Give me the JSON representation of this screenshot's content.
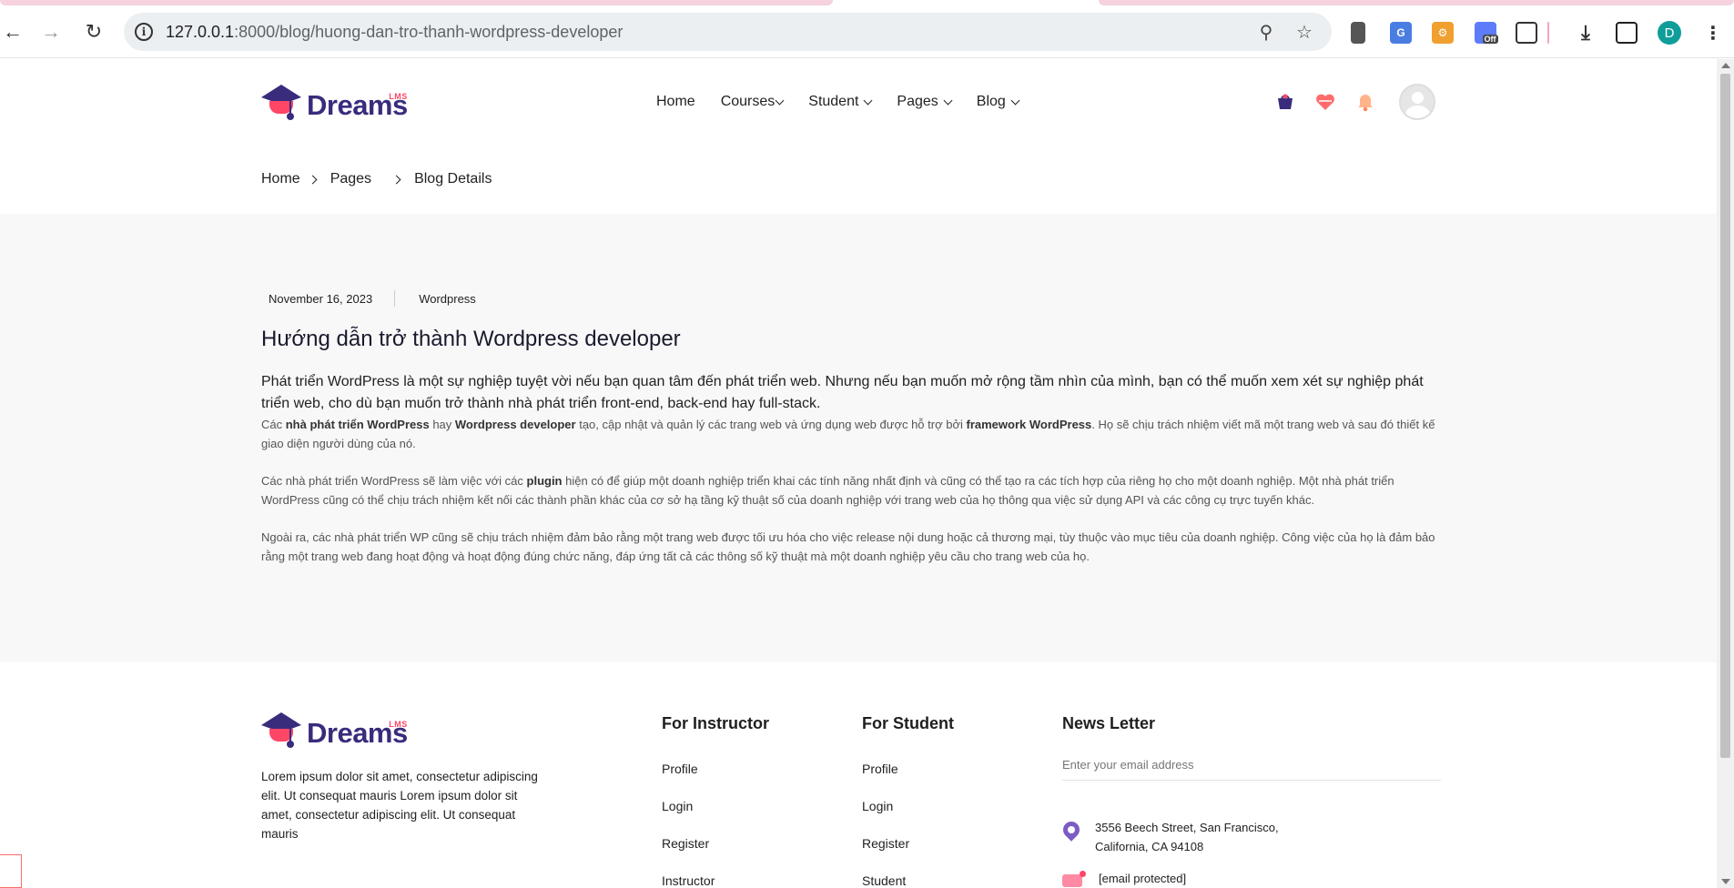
{
  "browser": {
    "url_host": "127.0.0.1",
    "url_rest": ":8000/blog/huong-dan-tro-thanh-wordpress-developer",
    "profile_letter": "D",
    "ext_off_label": "Off"
  },
  "brand": {
    "name": "Dreams",
    "badge": "LMS"
  },
  "nav": {
    "home": "Home",
    "courses": "Courses",
    "student": "Student",
    "pages": "Pages",
    "blog": "Blog"
  },
  "breadcrumb": {
    "home": "Home",
    "pages": "Pages",
    "current": "Blog Details"
  },
  "post": {
    "date": "November 16, 2023",
    "category": "Wordpress",
    "title": "Hướng dẫn trở thành Wordpress developer",
    "lead": "Phát triển WordPress là một sự nghiệp tuyệt vời nếu bạn quan tâm đến phát triển web. Nhưng nếu bạn muốn mở rộng tầm nhìn của mình, bạn có thể muốn xem xét sự nghiệp phát triển web, cho dù bạn muốn trở thành nhà phát triển front-end, back-end hay full-stack.",
    "p1": {
      "a": "Các ",
      "b1": "nhà phát triển WordPress",
      "c": " hay ",
      "b2": "Wordpress developer",
      "d": " tạo, cập nhật và quản lý các trang web và ứng dụng web được hỗ trợ bởi ",
      "b3": "framework WordPress",
      "e": ". Họ sẽ chịu trách nhiệm viết mã một trang web và sau đó thiết kế giao diện người dùng của nó."
    },
    "p2": {
      "a": "Các nhà phát triển WordPress sẽ làm việc với các ",
      "b1": "plugin",
      "c": " hiện có để giúp một doanh nghiệp triển khai các tính năng nhất định và cũng có thể tạo ra các tích hợp của riêng họ cho một doanh nghiệp. Một nhà phát triển WordPress cũng có thể chịu trách nhiệm kết nối các thành phần khác của cơ sở hạ tầng kỹ thuật số của doanh nghiệp với trang web của họ thông qua việc sử dụng API và các công cụ trực tuyến khác."
    },
    "p3": "Ngoài ra, các nhà phát triển WP cũng sẽ chịu trách nhiệm đảm bảo rằng một trang web được tối ưu hóa cho việc release nội dung hoặc cả thương mại, tùy thuộc vào mục tiêu của doanh nghiệp. Công việc của họ là đảm bảo rằng một trang web đang hoạt động và hoạt động đúng chức năng, đáp ứng tất cả các thông số kỹ thuật mà một doanh nghiệp yêu cầu cho trang web của họ."
  },
  "footer": {
    "about": "Lorem ipsum dolor sit amet, consectetur adipiscing elit. Ut consequat mauris Lorem ipsum dolor sit amet, consectetur adipiscing elit. Ut consequat mauris",
    "instructor": {
      "title": "For Instructor",
      "links": [
        "Profile",
        "Login",
        "Register",
        "Instructor"
      ]
    },
    "student": {
      "title": "For Student",
      "links": [
        "Profile",
        "Login",
        "Register",
        "Student"
      ]
    },
    "newsletter": {
      "title": "News Letter",
      "placeholder": "Enter your email address",
      "address_line1": "3556 Beech Street, San Francisco,",
      "address_line2": "California, CA 94108",
      "email": "[email protected]"
    }
  },
  "colors": {
    "brand": "#392c7d",
    "accent": "#ff4667",
    "band": "#f8f8f8"
  }
}
